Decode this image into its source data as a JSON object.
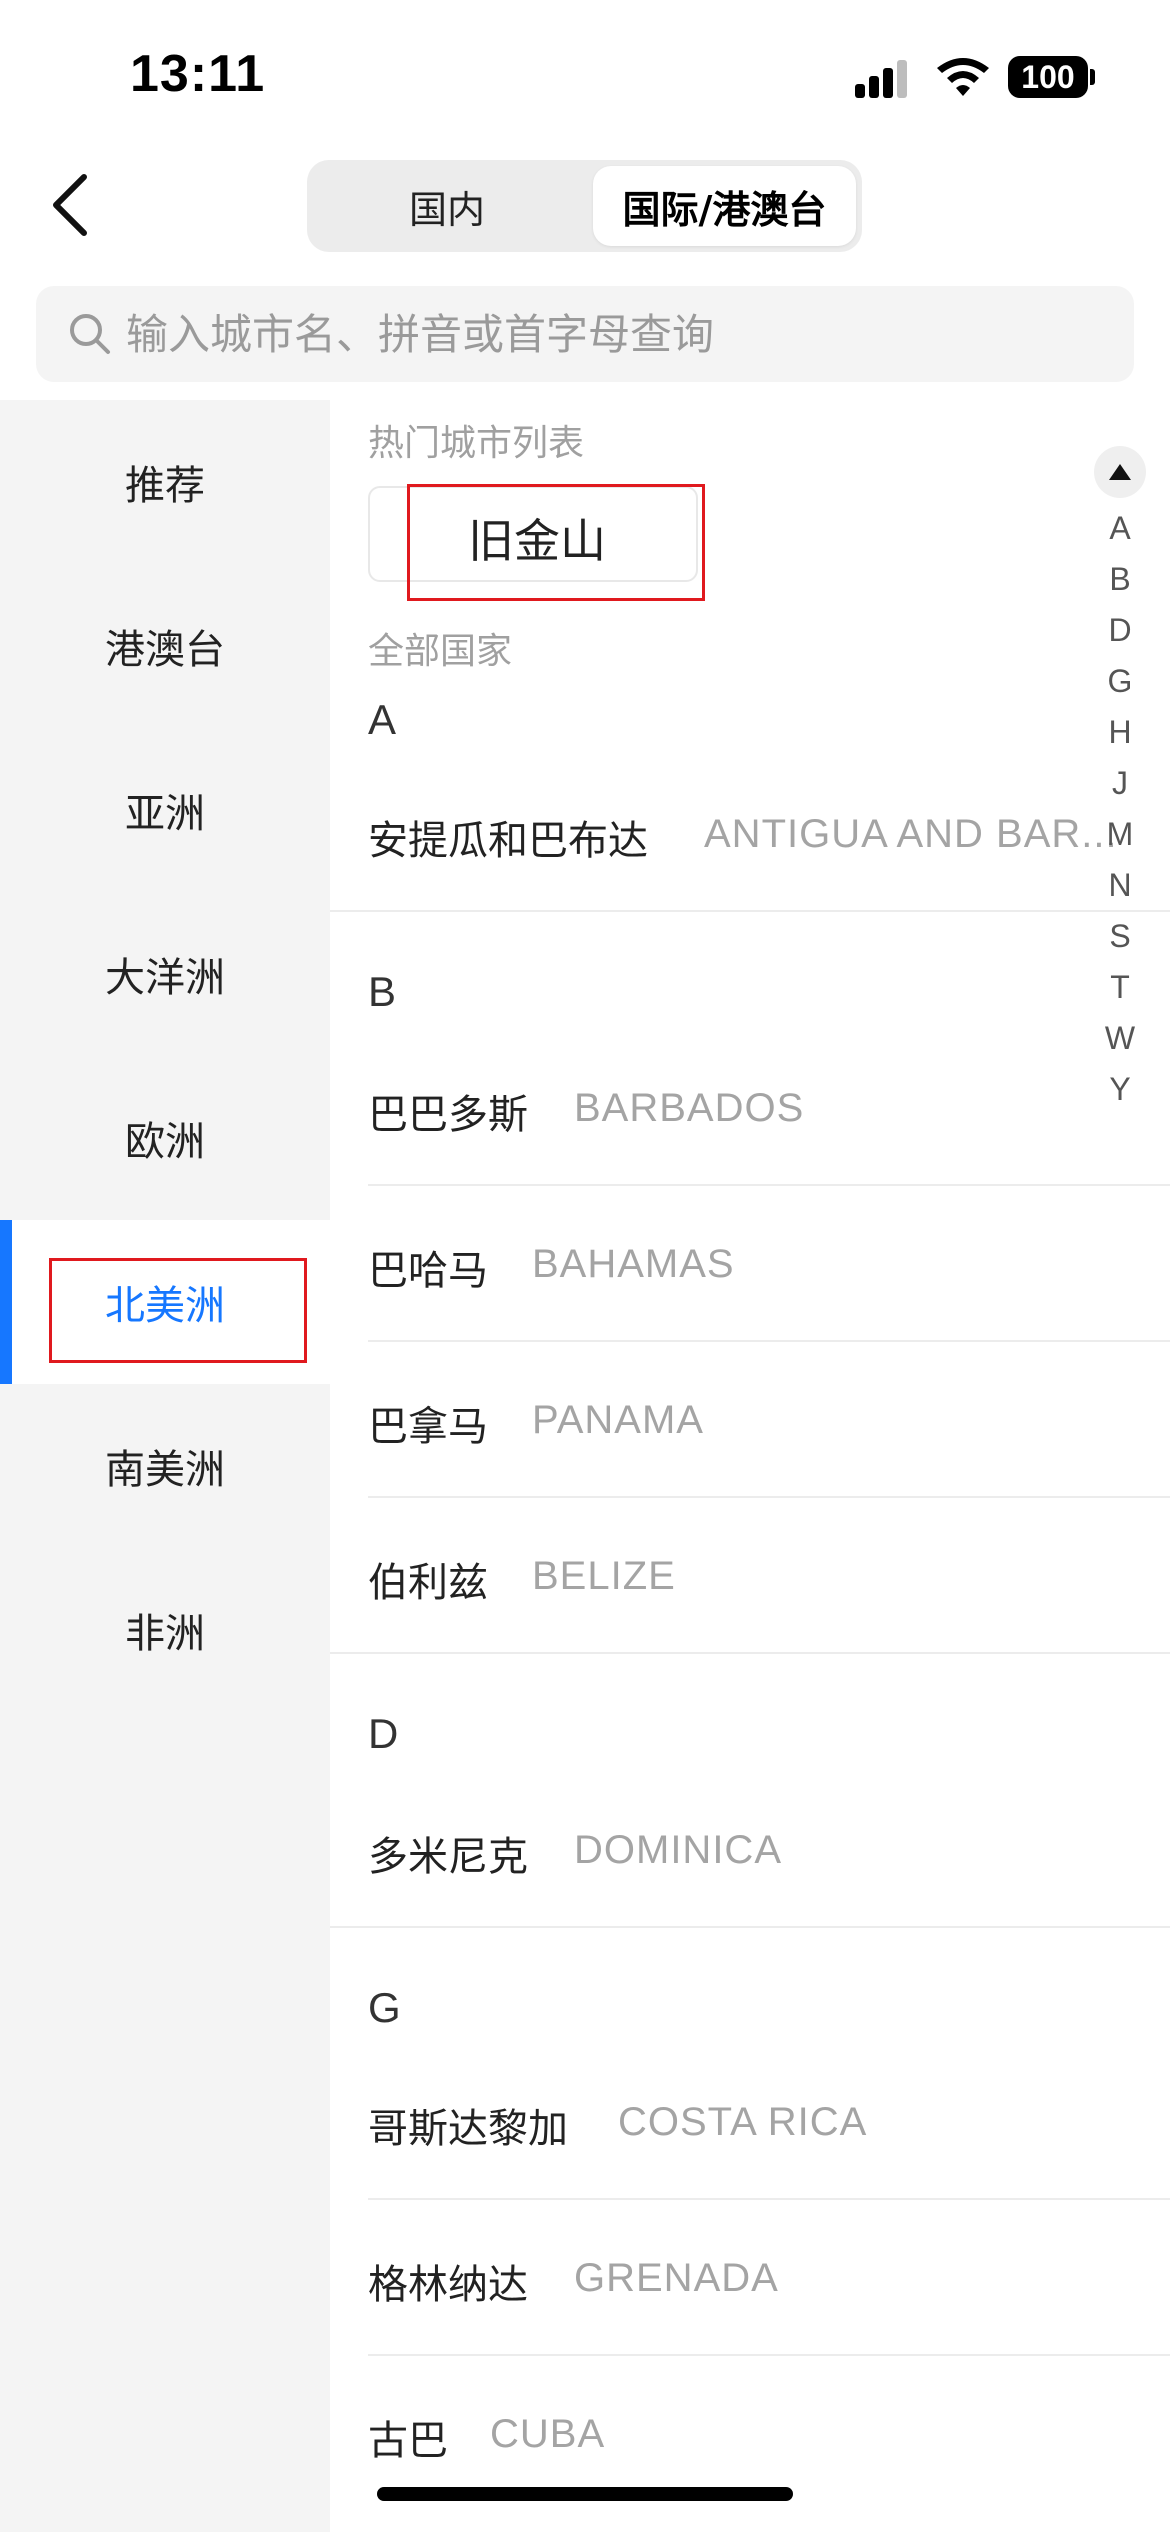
{
  "status_bar": {
    "time": "13:11",
    "battery": "100"
  },
  "header": {
    "tabs": [
      {
        "label": "国内",
        "active": false
      },
      {
        "label": "国际/港澳台",
        "active": true
      }
    ]
  },
  "search": {
    "placeholder": "输入城市名、拼音或首字母查询"
  },
  "sidebar": {
    "items": [
      {
        "label": "推荐"
      },
      {
        "label": "港澳台"
      },
      {
        "label": "亚洲"
      },
      {
        "label": "大洋洲"
      },
      {
        "label": "欧洲"
      },
      {
        "label": "北美洲",
        "active": true
      },
      {
        "label": "南美洲"
      },
      {
        "label": "非洲"
      }
    ]
  },
  "hot": {
    "title": "热门城市列表",
    "cities": [
      {
        "label": "旧金山"
      }
    ]
  },
  "all": {
    "title": "全部国家",
    "sections": [
      {
        "letter": "A",
        "countries": [
          {
            "cn": "安提瓜和巴布达",
            "en": "ANTIGUA AND BAR..."
          }
        ]
      },
      {
        "letter": "B",
        "countries": [
          {
            "cn": "巴巴多斯",
            "en": "BARBADOS"
          },
          {
            "cn": "巴哈马",
            "en": "BAHAMAS"
          },
          {
            "cn": "巴拿马",
            "en": "PANAMA"
          },
          {
            "cn": "伯利兹",
            "en": "BELIZE"
          }
        ]
      },
      {
        "letter": "D",
        "countries": [
          {
            "cn": "多米尼克",
            "en": "DOMINICA"
          }
        ]
      },
      {
        "letter": "G",
        "countries": [
          {
            "cn": "哥斯达黎加",
            "en": "COSTA RICA"
          },
          {
            "cn": "格林纳达",
            "en": "GRENADA"
          },
          {
            "cn": "古巴",
            "en": "CUBA"
          }
        ]
      }
    ]
  },
  "index_bar": {
    "letters": [
      "A",
      "B",
      "D",
      "G",
      "H",
      "J",
      "M",
      "N",
      "S",
      "T",
      "W",
      "Y"
    ]
  },
  "colors": {
    "accent": "#1677ff",
    "highlight_box": "#e0191e"
  }
}
